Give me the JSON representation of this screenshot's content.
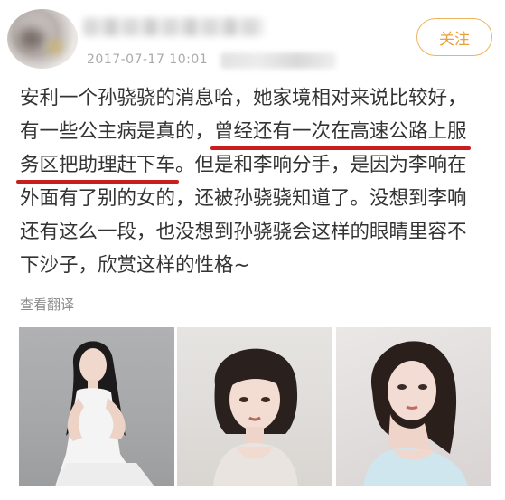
{
  "post": {
    "timestamp": "2017-07-17 10:01",
    "follow_label": "关注",
    "lines": [
      [
        "安利一个孙骁骁的消息哈，她家境相对来说比较好，",
        "",
        ""
      ],
      [
        "有一些公主病是真的，",
        "曾经还有一次在高速公路上服",
        ""
      ],
      [
        "",
        "务区把助理赶下车",
        "。但是和李响分手，是因为李响在"
      ],
      [
        "外面有了别的女的，还被孙骁骁知道了。没想到李响",
        "",
        ""
      ],
      [
        "还有这么一段，也没想到孙骁骁会这样的眼睛里容不",
        "",
        ""
      ],
      [
        "下沙子，欣赏这样的性格~",
        "",
        ""
      ]
    ],
    "translate_label": "查看翻译"
  },
  "colors": {
    "underline": "#c81e1e",
    "follow_accent": "#e8a23c",
    "timestamp": "#aaaaaa"
  },
  "photos": [
    "photo-woman-white-dress-sitting",
    "photo-woman-bob-haircut",
    "photo-woman-hand-on-chin"
  ]
}
